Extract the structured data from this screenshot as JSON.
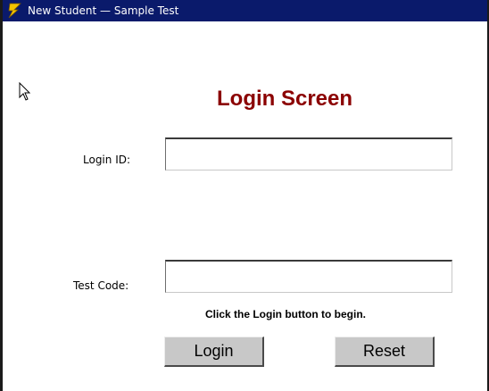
{
  "window": {
    "title": "New Student — Sample Test",
    "icon": "lightning-app-icon"
  },
  "cursor": {
    "icon": "mouse-pointer-icon"
  },
  "login": {
    "heading": "Login Screen",
    "login_id_label": "Login ID:",
    "login_id_value": "",
    "test_code_label": "Test Code:",
    "test_code_value": "",
    "instruction": "Click the Login button to begin.",
    "login_button_label": "Login",
    "reset_button_label": "Reset"
  },
  "colors": {
    "titlebar": "#0a1a6b",
    "heading": "#8b0000",
    "button_face": "#c8c8c8"
  }
}
